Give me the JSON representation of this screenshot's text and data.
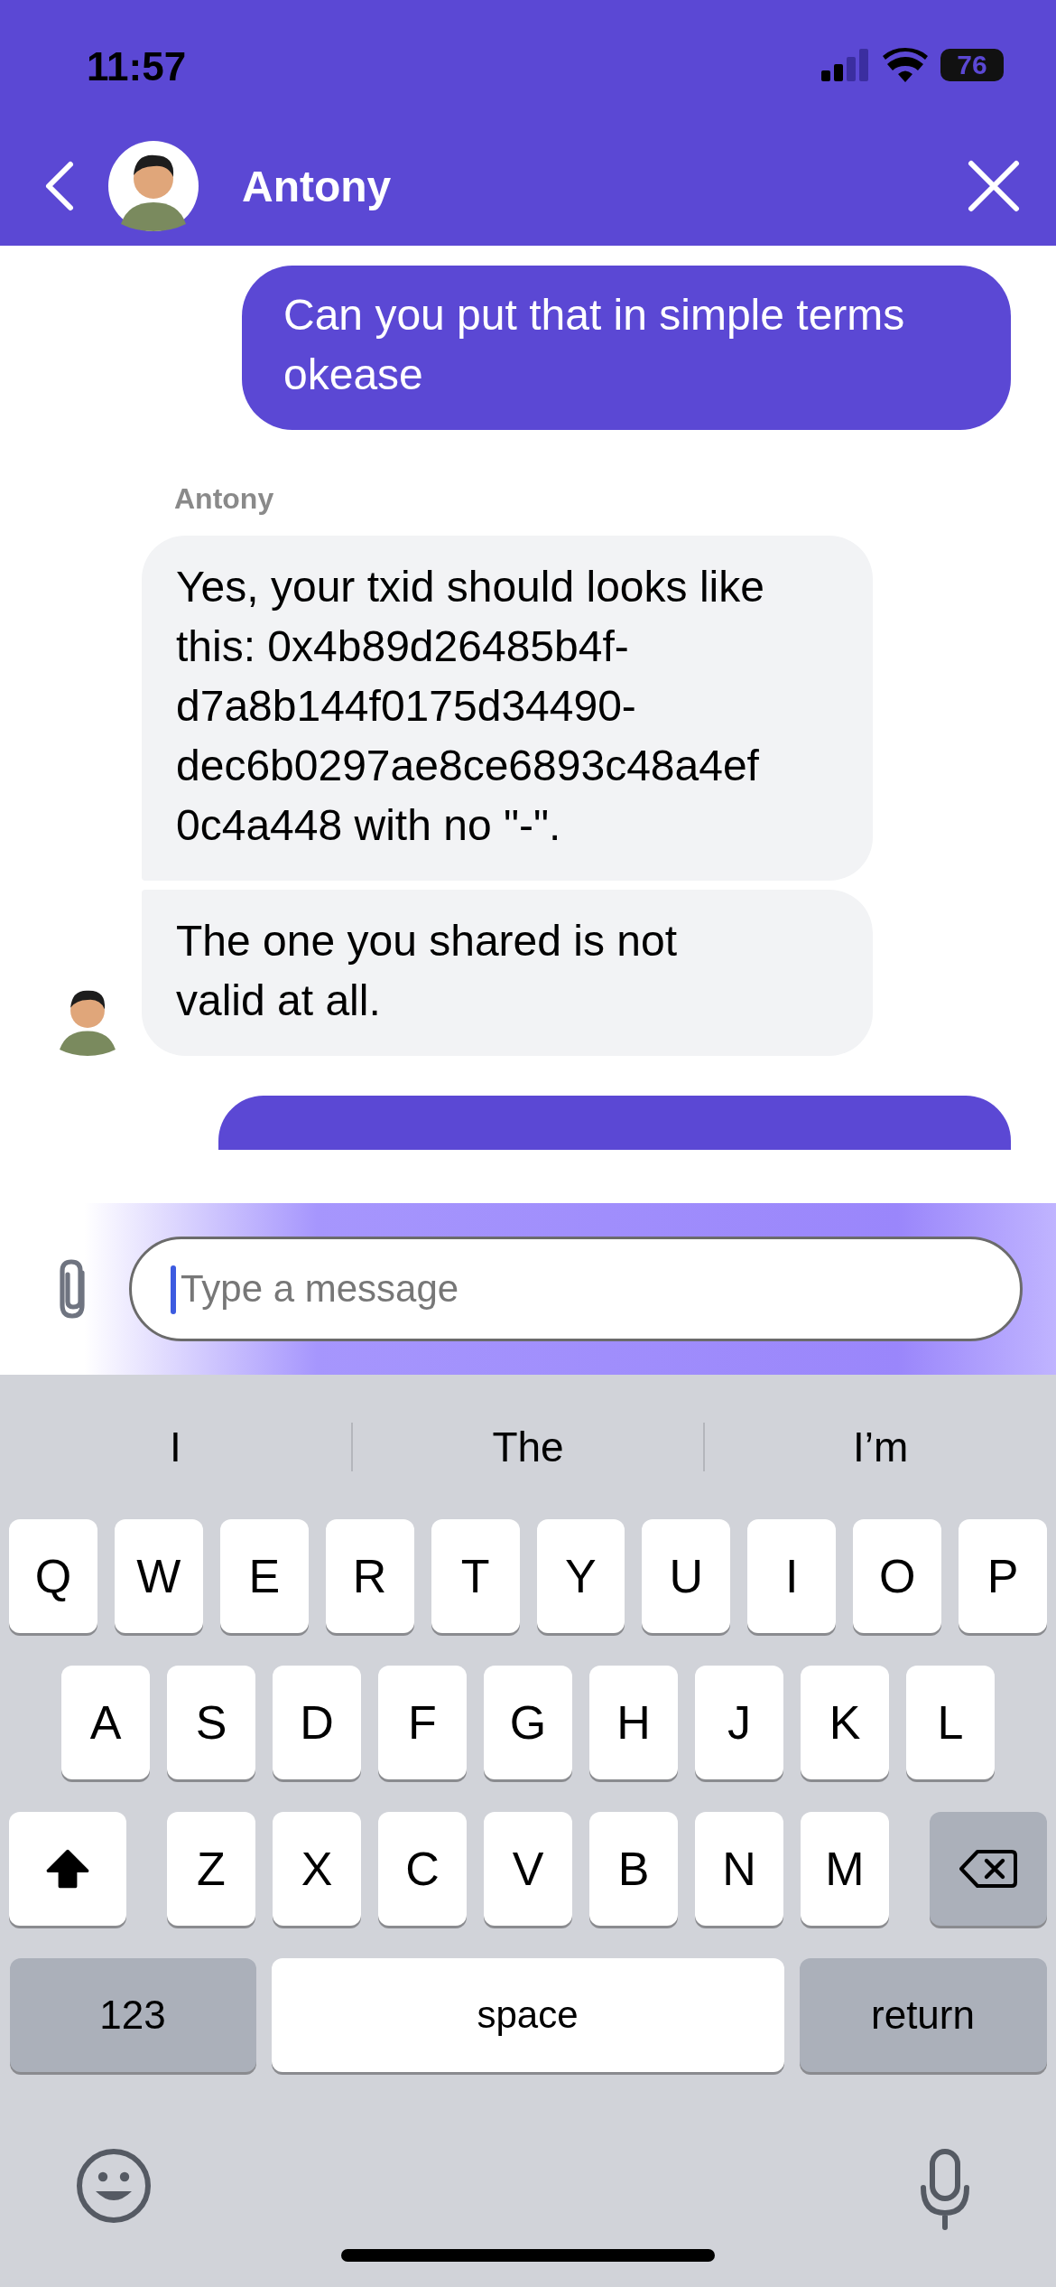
{
  "status_bar": {
    "time": "11:57",
    "battery": "76"
  },
  "header": {
    "title": "Antony"
  },
  "messages": [
    {
      "kind": "outgoing",
      "text": "Can you put that in simple terms okease"
    },
    {
      "kind": "sender",
      "text": "Antony"
    },
    {
      "kind": "incoming",
      "text": "Yes, your txid should looks like this: 0x4b89d26485b4f-d7a8b144f0175d34490-dec6b0297ae8ce6893c48a4ef0c4a448 with no \"-\".",
      "avatar": false
    },
    {
      "kind": "incoming",
      "text": "The one you shared is not valid at all.",
      "avatar": true
    },
    {
      "kind": "outgoing_hidden"
    }
  ],
  "composer": {
    "placeholder": "Type a message"
  },
  "suggestions": [
    "I",
    "The",
    "I’m"
  ],
  "keyboard": [
    {
      "keys": [
        {
          "kind": "letter",
          "label": "Q"
        },
        {
          "kind": "letter",
          "label": "W"
        },
        {
          "kind": "letter",
          "label": "E"
        },
        {
          "kind": "letter",
          "label": "R"
        },
        {
          "kind": "letter",
          "label": "T"
        },
        {
          "kind": "letter",
          "label": "Y"
        },
        {
          "kind": "letter",
          "label": "U"
        },
        {
          "kind": "letter",
          "label": "I"
        },
        {
          "kind": "letter",
          "label": "O"
        },
        {
          "kind": "letter",
          "label": "P"
        }
      ]
    },
    {
      "keys": [
        {
          "kind": "letter",
          "label": "A"
        },
        {
          "kind": "letter",
          "label": "S"
        },
        {
          "kind": "letter",
          "label": "D"
        },
        {
          "kind": "letter",
          "label": "F"
        },
        {
          "kind": "letter",
          "label": "G"
        },
        {
          "kind": "letter",
          "label": "H"
        },
        {
          "kind": "letter",
          "label": "J"
        },
        {
          "kind": "letter",
          "label": "K"
        },
        {
          "kind": "letter",
          "label": "L"
        }
      ]
    },
    {
      "keys": [
        {
          "kind": "shift",
          "on": true
        },
        {
          "kind": "letter",
          "label": "Z"
        },
        {
          "kind": "letter",
          "label": "X"
        },
        {
          "kind": "letter",
          "label": "C"
        },
        {
          "kind": "letter",
          "label": "V"
        },
        {
          "kind": "letter",
          "label": "B"
        },
        {
          "kind": "letter",
          "label": "N"
        },
        {
          "kind": "letter",
          "label": "M"
        },
        {
          "kind": "backspace"
        }
      ]
    },
    {
      "keys": [
        {
          "kind": "mode",
          "label": "123"
        },
        {
          "kind": "space",
          "label": "space"
        },
        {
          "kind": "return",
          "label": "return"
        }
      ]
    }
  ]
}
